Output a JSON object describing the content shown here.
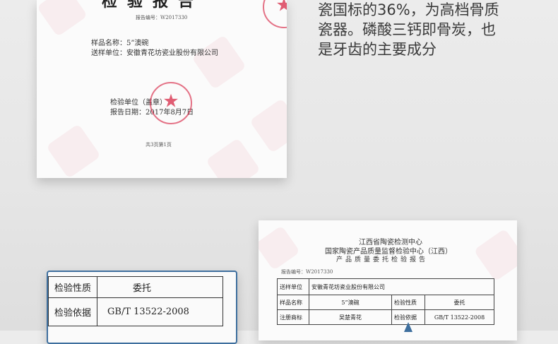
{
  "report_top": {
    "title": "检验报告",
    "report_no": "报告编号：W2017330",
    "sample_name": "样品名称：5”澳碗",
    "sender": "送样单位：安徽青花坊瓷业股份有限公司",
    "inspector": "检验单位（盖章）",
    "report_date": "报告日期：2017年8月7日",
    "page": "共3页第1页"
  },
  "description": {
    "lines": [
      "瓷国标的36%，为高档骨质",
      "瓷器。磷酸三钙即骨炭，也",
      "是牙齿的主要成分"
    ]
  },
  "report_table_closeup": {
    "rows": [
      {
        "label": "检验性质",
        "value": "委托"
      },
      {
        "label": "检验依据",
        "value": "GB/T 13522-2008"
      }
    ]
  },
  "report_bottom": {
    "center_line1": "江西省陶瓷检测中心",
    "center_line2": "国家陶瓷产品质量监督检验中心（江西）",
    "report_type": "产品质量委托检验报告",
    "report_no": "报告编号：W2017330",
    "rows": [
      {
        "label": "送样单位",
        "value": "安徽青花坊瓷业股份有限公司"
      },
      {
        "label": "样品名称",
        "value": "5”澳碗",
        "label2": "检验性质",
        "value2": "委托"
      },
      {
        "label": "注册商标",
        "value": "吴楚青花",
        "label2": "检验依据",
        "value2": "GB/T 13522-2008"
      }
    ]
  },
  "colors": {
    "seal": "#d72846",
    "frame": "#3e6f9e"
  }
}
